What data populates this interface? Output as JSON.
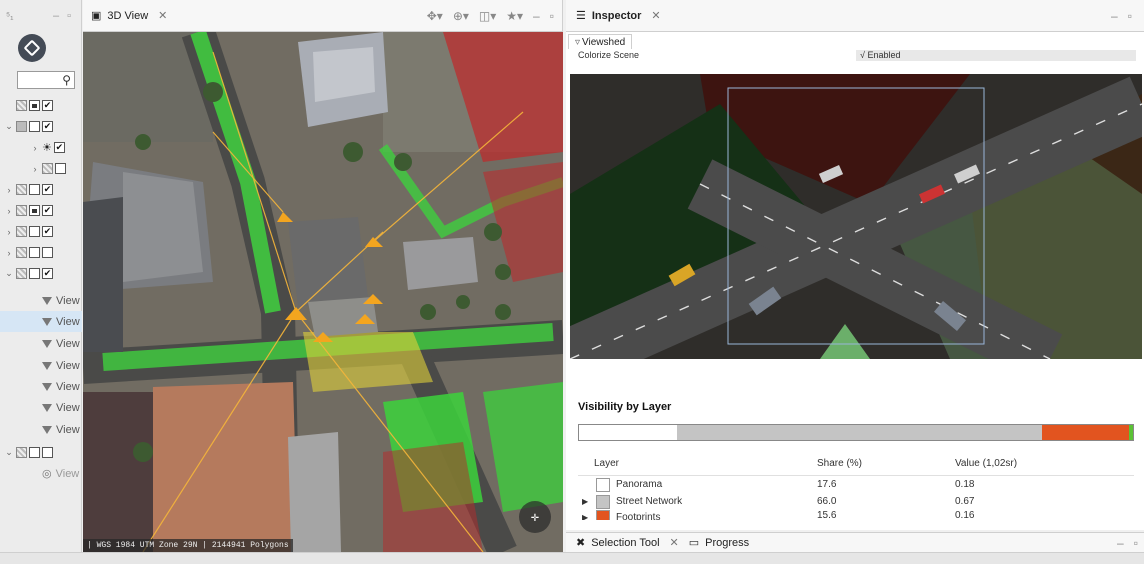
{
  "left_panel": {
    "view_items": [
      "View",
      "View",
      "View",
      "View",
      "View",
      "View",
      "View",
      "View"
    ]
  },
  "view3d": {
    "tab_label": "3D View",
    "status": "| WGS 1984 UTM Zone 29N | 2144941 Polygons"
  },
  "inspector": {
    "tab_label": "Inspector",
    "subtab_label": "Viewshed",
    "colorize_label": "Colorize Scene",
    "colorize_value": "√ Enabled",
    "visibility_title": "Visibility by Layer",
    "bar": [
      {
        "share": 17.6,
        "color": "#ffffff"
      },
      {
        "share": 66.0,
        "color": "#c4c4c4"
      },
      {
        "share": 15.6,
        "color": "#e2541f"
      },
      {
        "share": 0.8,
        "color": "#5bc236"
      }
    ],
    "columns": {
      "layer": "Layer",
      "share": "Share (%)",
      "value": "Value (1,02sr)"
    },
    "rows": [
      {
        "name": "Panorama",
        "share": "17.6",
        "value": "0.18",
        "color": "#ffffff",
        "expand": ""
      },
      {
        "name": "Street Network",
        "share": "66.0",
        "value": "0.67",
        "color": "#c4c4c4",
        "expand": "▶"
      },
      {
        "name": "Footprints",
        "share": "15.6",
        "value": "0.16",
        "color": "#e2541f",
        "expand": "▶"
      }
    ]
  },
  "bottom_bar": {
    "selection_tool_label": "Selection Tool",
    "progress_label": "Progress"
  }
}
